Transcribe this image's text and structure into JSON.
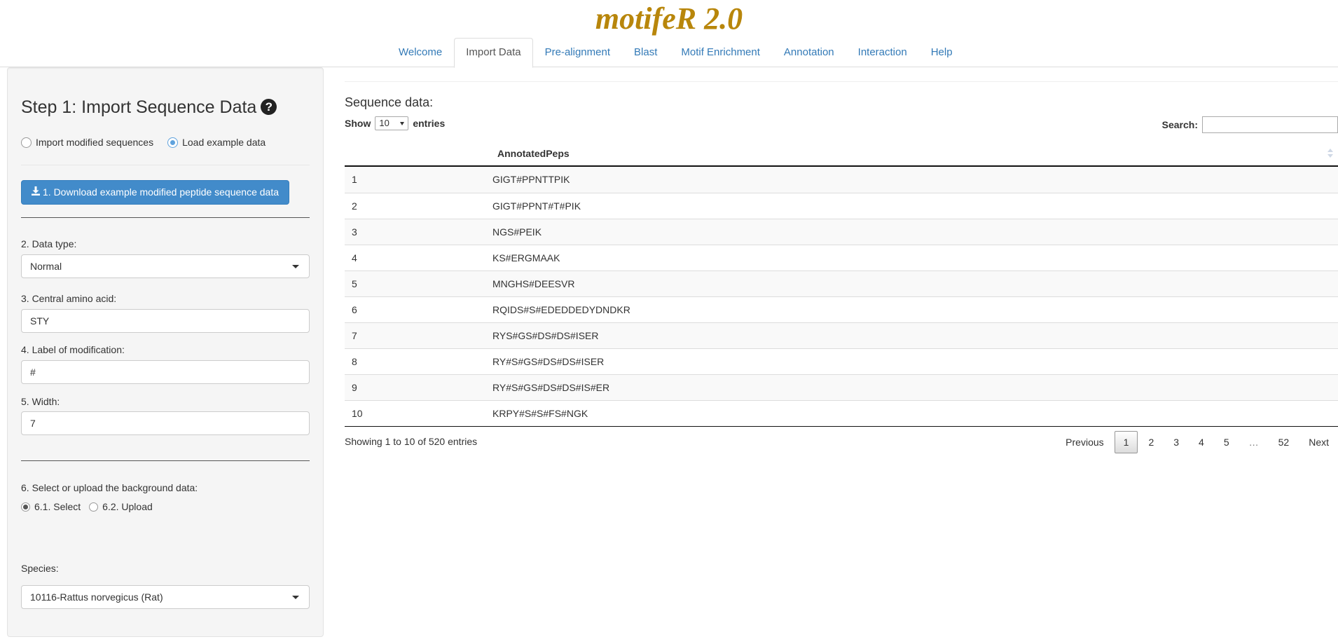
{
  "app": {
    "brand": "motifeR 2.0"
  },
  "nav": {
    "tabs": [
      {
        "label": "Welcome"
      },
      {
        "label": "Import Data"
      },
      {
        "label": "Pre-alignment"
      },
      {
        "label": "Blast"
      },
      {
        "label": "Motif Enrichment"
      },
      {
        "label": "Annotation"
      },
      {
        "label": "Interaction"
      },
      {
        "label": "Help"
      }
    ],
    "active_tab": "Import Data"
  },
  "sidebar": {
    "title": "Step 1: Import Sequence Data",
    "help_icon": "question-circle-icon",
    "source_options": [
      {
        "label": "Import modified sequences",
        "selected": false
      },
      {
        "label": "Load example data",
        "selected": true
      }
    ],
    "download_button": {
      "label": "1. Download example modified peptide sequence data",
      "icon": "download-icon",
      "color": "#428bca"
    },
    "data_type": {
      "label": "2. Data type:",
      "value": "Normal"
    },
    "central_aa": {
      "label": "3. Central amino acid:",
      "value": "STY"
    },
    "mod_label": {
      "label": "4. Label of modification:",
      "value": "#"
    },
    "width": {
      "label": "5. Width:",
      "value": "7"
    },
    "background": {
      "label": "6. Select or upload the background data:",
      "options": [
        {
          "label": "6.1. Select",
          "selected": true
        },
        {
          "label": "6.2. Upload",
          "selected": false
        }
      ]
    },
    "species": {
      "label": "Species:",
      "value": "10116-Rattus norvegicus (Rat)"
    }
  },
  "main": {
    "section_title": "Sequence data:",
    "length": {
      "show": "Show",
      "value": "10",
      "entries": "entries"
    },
    "search": {
      "label": "Search:",
      "value": ""
    },
    "table": {
      "columns": [
        "",
        "AnnotatedPeps"
      ],
      "rows": [
        {
          "index": "1",
          "pep": "GIGT#PPNTTPIK"
        },
        {
          "index": "2",
          "pep": "GIGT#PPNT#T#PIK"
        },
        {
          "index": "3",
          "pep": "NGS#PEIK"
        },
        {
          "index": "4",
          "pep": "KS#ERGMAAK"
        },
        {
          "index": "5",
          "pep": "MNGHS#DEESVR"
        },
        {
          "index": "6",
          "pep": "RQIDS#S#EDEDDEDYDNDKR"
        },
        {
          "index": "7",
          "pep": "RYS#GS#DS#DS#ISER"
        },
        {
          "index": "8",
          "pep": "RY#S#GS#DS#DS#ISER"
        },
        {
          "index": "9",
          "pep": "RY#S#GS#DS#DS#IS#ER"
        },
        {
          "index": "10",
          "pep": "KRPY#S#S#FS#NGK"
        }
      ]
    },
    "info": "Showing 1 to 10 of 520 entries",
    "pagination": {
      "previous": "Previous",
      "pages": [
        "1",
        "2",
        "3",
        "4",
        "5"
      ],
      "ellipsis": "…",
      "last": "52",
      "next": "Next",
      "current": "1"
    }
  }
}
